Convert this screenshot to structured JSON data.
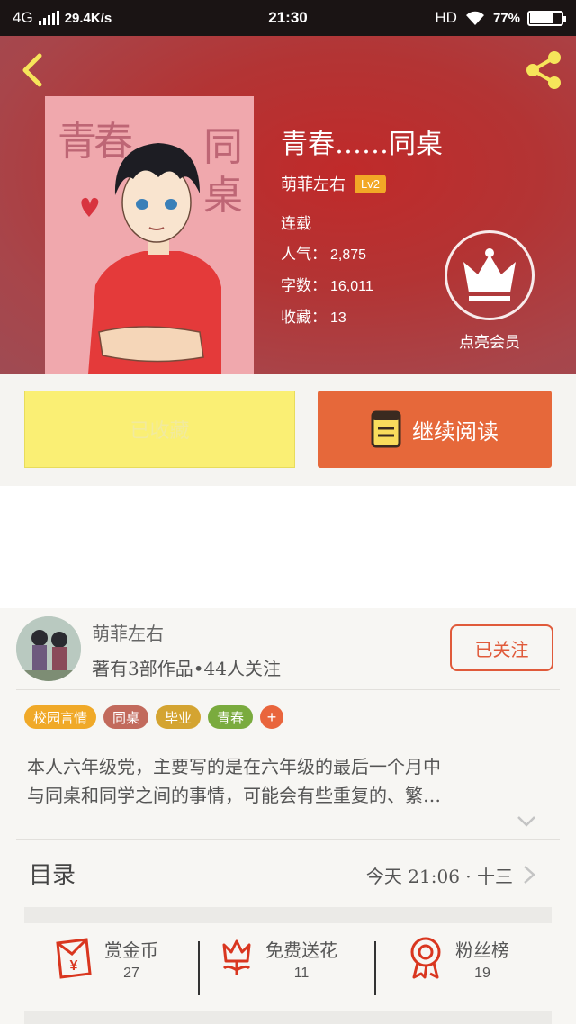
{
  "status_bar": {
    "network": "4G",
    "speed": "29.4K/s",
    "time": "21:30",
    "hd": "HD",
    "battery": "77%",
    "battery_level": 0.77
  },
  "book": {
    "title": "青春……同桌",
    "cover_text_top": "青春",
    "cover_text_side": "同桌",
    "author": "萌菲左右",
    "level": "Lv2",
    "status": "连载",
    "popularity_label": "人气：",
    "popularity": "2,875",
    "words_label": "字数：",
    "words": "16,011",
    "favorites_label": "收藏：",
    "favorites": "13",
    "vip_label": "点亮会员"
  },
  "actions": {
    "favorited_label": "已收藏",
    "continue_label": "继续阅读"
  },
  "author": {
    "name": "萌菲左右",
    "info": "著有3部作品•44人关注",
    "follow_label": "已关注"
  },
  "tags": [
    {
      "label": "校园言情",
      "color": "#f0a928"
    },
    {
      "label": "同桌",
      "color": "#c26a5c"
    },
    {
      "label": "毕业",
      "color": "#d4a431"
    },
    {
      "label": "青春",
      "color": "#7aab3e"
    },
    {
      "label": "+",
      "color": "#e9653c"
    }
  ],
  "description": {
    "line1": "本人六年级党，主要写的是在六年级的最后一个月中",
    "line2": "与同桌和同学之间的事情，可能会有些重复的、繁…"
  },
  "toc": {
    "label": "目录",
    "latest": "今天 21:06 · 十三"
  },
  "stats": [
    {
      "label": "赏金币",
      "value": "27",
      "icon": "red-envelope-icon"
    },
    {
      "label": "免费送花",
      "value": "11",
      "icon": "flower-icon"
    },
    {
      "label": "粉丝榜",
      "value": "19",
      "icon": "medal-icon"
    }
  ],
  "colors": {
    "accent": "#e6683a",
    "favorite_bg": "#faef74",
    "icon_red": "#d9361f"
  }
}
